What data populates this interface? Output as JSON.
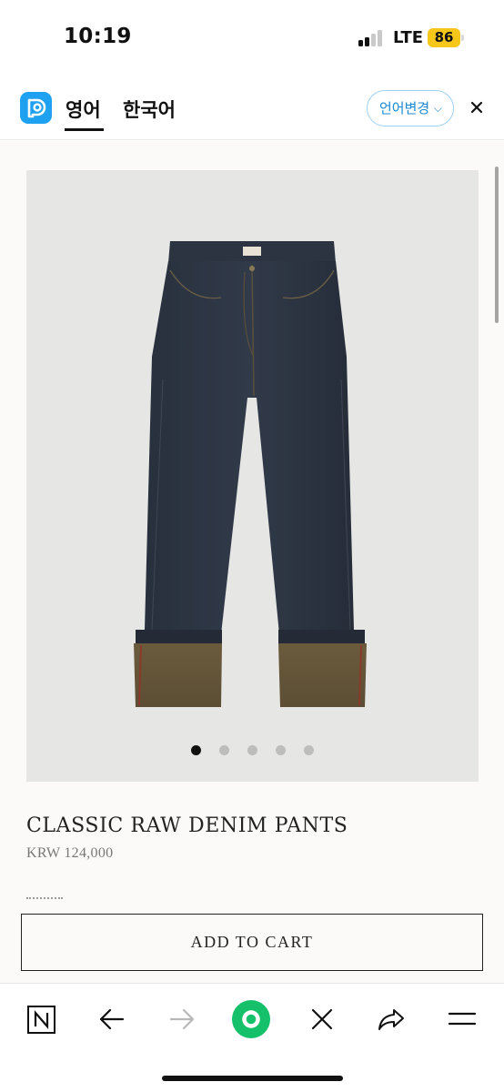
{
  "status_bar": {
    "time": "10:19",
    "network": "LTE",
    "battery": "86",
    "battery_color": "#f6c619"
  },
  "translate_bar": {
    "logo_icon": "papago-logo-icon",
    "active_language": "영어",
    "other_language": "한국어",
    "change_language_label": "언어변경",
    "accent_color": "#1ea1f1"
  },
  "product": {
    "image_alt": "jeans-photo",
    "carousel": {
      "total": 5,
      "active_index": 0
    },
    "title": "CLASSIC RAW DENIM PANTS",
    "price": "KRW 124,000",
    "add_to_cart_label": "ADD TO CART"
  },
  "toolbar": {
    "items": [
      "n-home-icon",
      "back-arrow-icon",
      "forward-arrow-icon",
      "green-dot-icon",
      "close-x-icon",
      "share-icon",
      "menu-icon"
    ],
    "accent_color": "#14c16a"
  }
}
